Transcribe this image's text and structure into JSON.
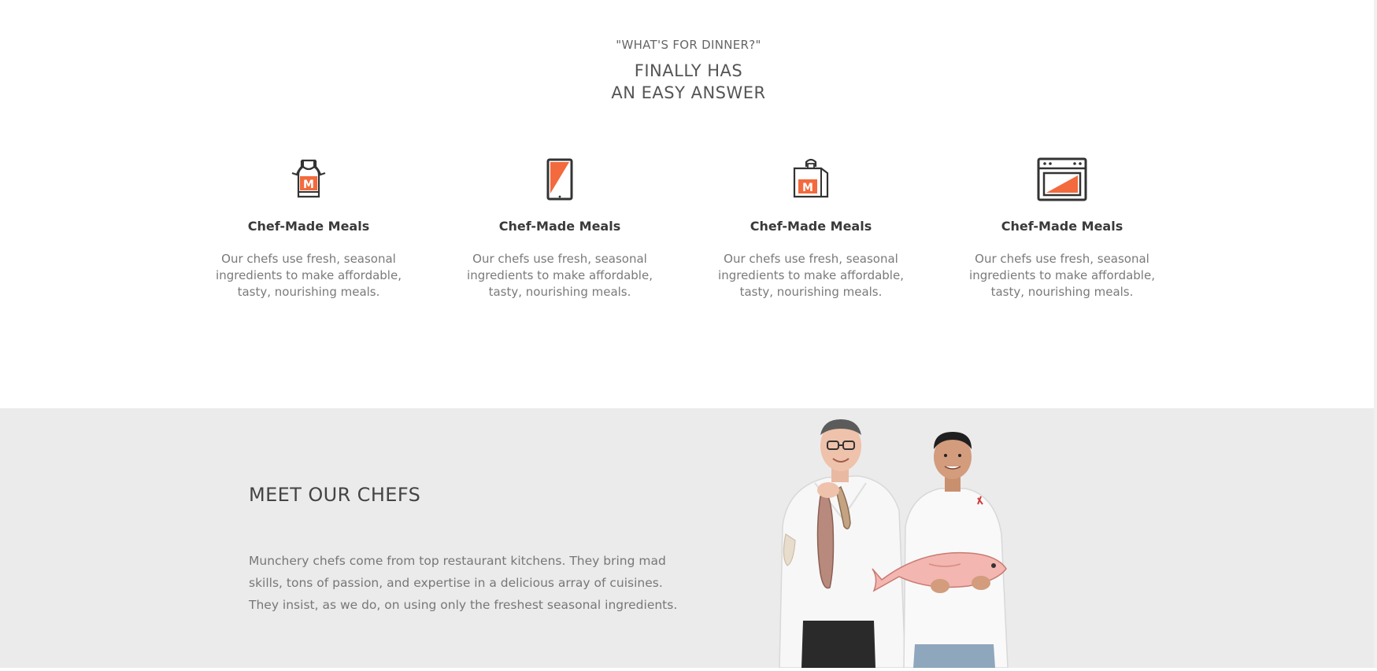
{
  "intro": {
    "kicker": "\"WHAT'S FOR DINNER?\"",
    "headline_line1": "FINALLY HAS",
    "headline_line2": "AN EASY ANSWER"
  },
  "features": [
    {
      "icon": "apron-icon",
      "title": "Chef-Made Meals",
      "description": "Our chefs use fresh, seasonal ingredients to make affordable, tasty, nourishing meals."
    },
    {
      "icon": "tablet-icon",
      "title": "Chef-Made Meals",
      "description": "Our chefs use fresh, seasonal ingredients to make affordable, tasty, nourishing meals."
    },
    {
      "icon": "delivery-bag-icon",
      "title": "Chef-Made Meals",
      "description": "Our chefs use fresh, seasonal ingredients to make affordable, tasty, nourishing meals."
    },
    {
      "icon": "oven-icon",
      "title": "Chef-Made Meals",
      "description": "Our chefs use fresh, seasonal ingredients to make affordable, tasty, nourishing meals."
    }
  ],
  "chefs": {
    "title": "MEET OUR CHEFS",
    "body": "Munchery chefs come from top restaurant kitchens. They bring mad skills, tons of passion, and expertise in a delicious array of cuisines. They insist, as we do, on using only the freshest seasonal ingredients."
  },
  "colors": {
    "accent": "#f26a3d",
    "icon_stroke": "#333333",
    "section_gray": "#ebebeb"
  }
}
